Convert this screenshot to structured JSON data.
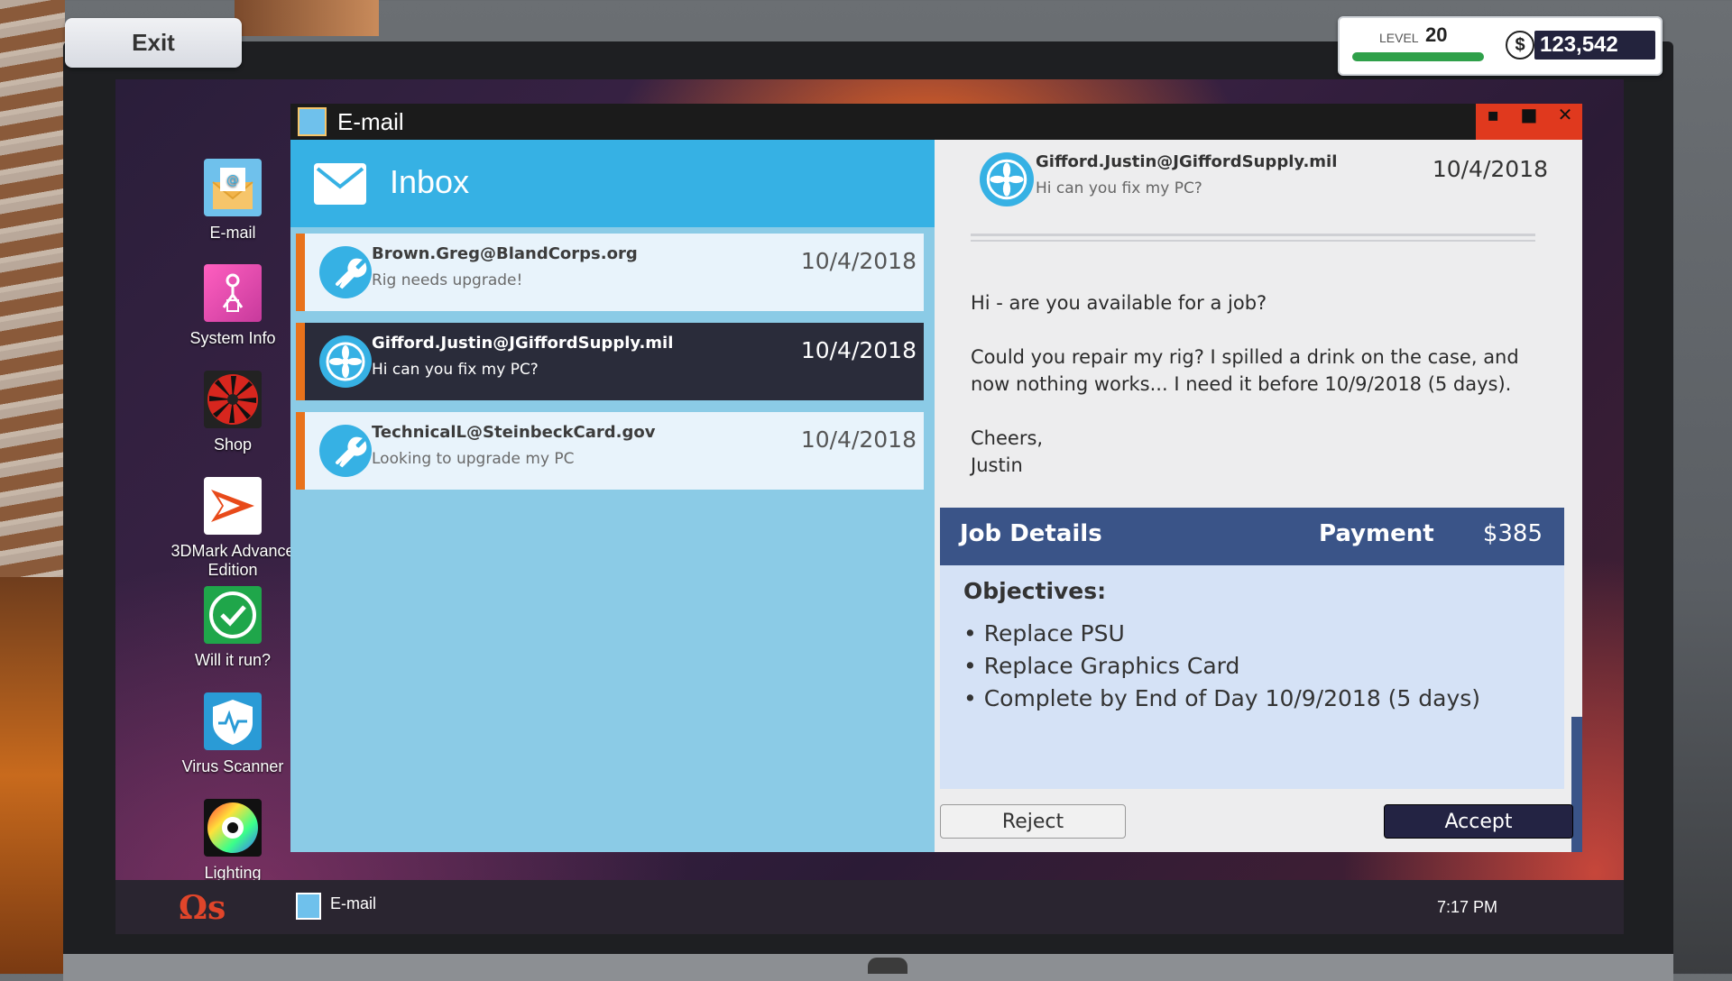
{
  "exit_label": "Exit",
  "hud": {
    "level_label": "LEVEL",
    "level": "20",
    "level_progress": 1.0,
    "currency_symbol": "$",
    "money": "123,542"
  },
  "desktop": {
    "icons": [
      {
        "label": "E-mail"
      },
      {
        "label": "System Info"
      },
      {
        "label": "Shop"
      },
      {
        "label": "3DMark Advance",
        "label2": "Edition"
      },
      {
        "label": "Will it run?"
      },
      {
        "label": "Virus Scanner"
      },
      {
        "label": "Lighting"
      }
    ]
  },
  "window": {
    "title": "E-mail"
  },
  "inbox": {
    "title": "Inbox",
    "mails": [
      {
        "from": "Brown.Greg@BlandCorps.org",
        "subject": "Rig needs upgrade!",
        "date": "10/4/2018"
      },
      {
        "from": "Gifford.Justin@JGiffordSupply.mil",
        "subject": "Hi can you fix my PC?",
        "date": "10/4/2018"
      },
      {
        "from": "TechnicalL@SteinbeckCard.gov",
        "subject": "Looking to upgrade my PC",
        "date": "10/4/2018"
      }
    ]
  },
  "message": {
    "from": "Gifford.Justin@JGiffordSupply.mil",
    "subject": "Hi can you fix my PC?",
    "date": "10/4/2018",
    "line1": "Hi - are you available for a job?",
    "line2": "Could you repair my rig? I spilled a drink on the case, and now nothing works... I need it before 10/9/2018 (5 days).",
    "line3a": "Cheers,",
    "line3b": "Justin"
  },
  "job": {
    "title": "Job Details",
    "payment_label": "Payment",
    "payment": "$385",
    "objectives_title": "Objectives:",
    "objectives": [
      "• Replace PSU",
      "• Replace Graphics Card",
      "• Complete by End of Day 10/9/2018 (5 days)"
    ],
    "reject_label": "Reject",
    "accept_label": "Accept"
  },
  "taskbar": {
    "os_logo": "Ωs",
    "app_label": "E-mail",
    "time": "7:17 PM"
  },
  "colors": {
    "accent_blue": "#36b1e4",
    "selected_row": "#2a2c3a",
    "unread_marker": "#e8721b",
    "job_header": "#3a5488",
    "accept": "#232343"
  }
}
